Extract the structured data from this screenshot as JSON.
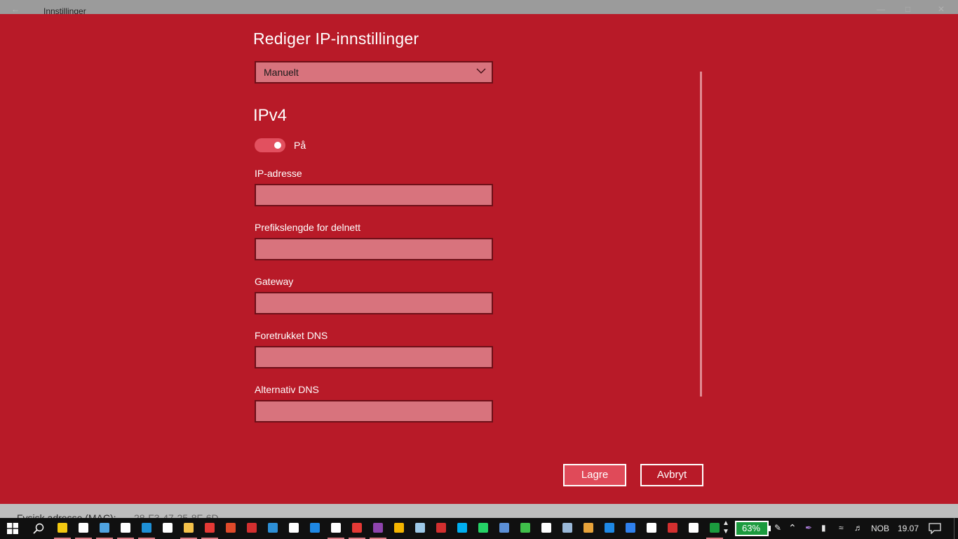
{
  "background_window": {
    "title": "Innstillinger",
    "footer_label": "Fysisk adresse (MAC):",
    "footer_value": "28-F3-47-25-8F-6D"
  },
  "dialog": {
    "title": "Rediger IP-innstillinger",
    "mode_value": "Manuelt",
    "ipv4_heading": "IPv4",
    "toggle_label": "På",
    "toggle_on": true,
    "fields": [
      {
        "label": "IP-adresse",
        "value": ""
      },
      {
        "label": "Prefikslengde for delnett",
        "value": ""
      },
      {
        "label": "Gateway",
        "value": ""
      },
      {
        "label": "Foretrukket DNS",
        "value": ""
      },
      {
        "label": "Alternativ DNS",
        "value": ""
      }
    ],
    "save_label": "Lagre",
    "cancel_label": "Avbryt"
  },
  "taskbar": {
    "apps": [
      {
        "name": "store-icon",
        "color": "#f2c811"
      },
      {
        "name": "settings-icon",
        "color": "#ffffff"
      },
      {
        "name": "outlook-icon",
        "color": "#4fa3e0"
      },
      {
        "name": "tips-icon",
        "color": "#ffffff"
      },
      {
        "name": "l-app-icon",
        "color": "#1e90d6"
      },
      {
        "name": "share-icon",
        "color": "#ffffff"
      },
      {
        "name": "file-explorer-icon",
        "color": "#f5c24a"
      },
      {
        "name": "lock-app-icon",
        "color": "#e53935"
      },
      {
        "name": "red-app-icon",
        "color": "#e04a2a"
      },
      {
        "name": "news-icon",
        "color": "#d32f2f"
      },
      {
        "name": "blue-app-icon",
        "color": "#2d8fd6"
      },
      {
        "name": "mail-icon",
        "color": "#ffffff"
      },
      {
        "name": "edge-icon",
        "color": "#1e88e5"
      },
      {
        "name": "camera-icon",
        "color": "#ffffff"
      },
      {
        "name": "opera-icon",
        "color": "#e53935"
      },
      {
        "name": "onenote-icon",
        "color": "#8e44ad"
      },
      {
        "name": "chrome-icon",
        "color": "#f4b400"
      },
      {
        "name": "notepad-icon",
        "color": "#9ec9e8"
      },
      {
        "name": "calculator-red-icon",
        "color": "#d32f2f"
      },
      {
        "name": "skype-icon",
        "color": "#00aff0"
      },
      {
        "name": "whatsapp-icon",
        "color": "#25d366"
      },
      {
        "name": "translator-icon",
        "color": "#5b8fd6"
      },
      {
        "name": "line-icon",
        "color": "#3fbf4a"
      },
      {
        "name": "alarm-icon",
        "color": "#ffffff"
      },
      {
        "name": "keyboard-icon",
        "color": "#9ab8d8"
      },
      {
        "name": "paint-icon",
        "color": "#e8a33a"
      },
      {
        "name": "remote-desktop-icon",
        "color": "#1e88e5"
      },
      {
        "name": "messenger-icon",
        "color": "#2f80ed"
      },
      {
        "name": "dropbox-icon",
        "color": "#ffffff"
      },
      {
        "name": "pdf-icon",
        "color": "#d32f2f"
      },
      {
        "name": "calculator-icon",
        "color": "#ffffff"
      },
      {
        "name": "green-app-icon",
        "color": "#1b9b3e"
      }
    ],
    "battery_percent": "63%",
    "language": "NOB",
    "clock": "19.07"
  }
}
